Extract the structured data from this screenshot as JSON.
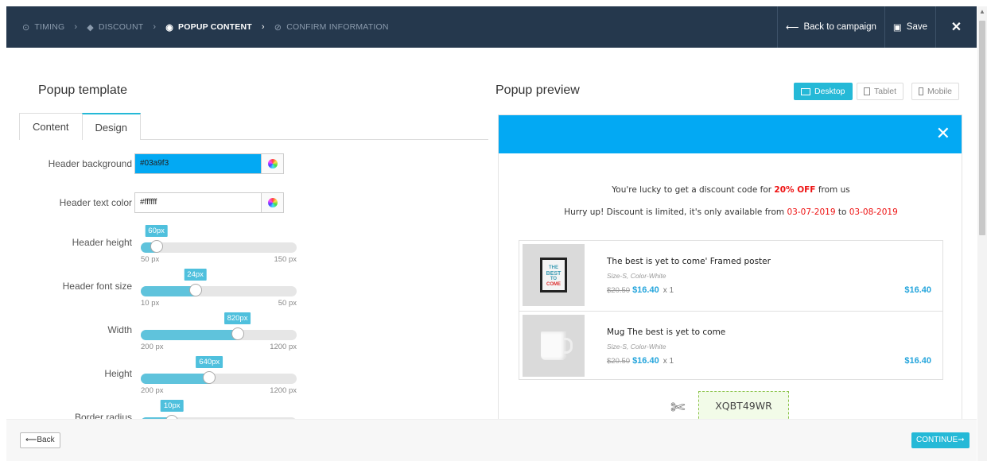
{
  "steps": [
    {
      "label": "TIMING",
      "icon": "clock-icon",
      "state": "done"
    },
    {
      "label": "DISCOUNT",
      "icon": "tag-icon",
      "state": "done"
    },
    {
      "label": "POPUP CONTENT",
      "icon": "eye-icon",
      "state": "active"
    },
    {
      "label": "CONFIRM INFORMATION",
      "icon": "check-circle-icon",
      "state": "pending"
    }
  ],
  "nav": {
    "back_label": "Back to campaign",
    "save_label": "Save"
  },
  "left": {
    "title": "Popup template",
    "tabs": [
      "Content",
      "Design"
    ],
    "active_tab": "Design",
    "fields": {
      "header_background": {
        "label": "Header background",
        "value": "#03a9f3"
      },
      "header_text_color": {
        "label": "Header text color",
        "value": "#ffffff"
      }
    },
    "sliders": [
      {
        "label": "Header height",
        "value": "60px",
        "min": "50 px",
        "max": "150 px",
        "fraction": 0.1
      },
      {
        "label": "Header font size",
        "value": "24px",
        "min": "10 px",
        "max": "50 px",
        "fraction": 0.35
      },
      {
        "label": "Width",
        "value": "820px",
        "min": "200 px",
        "max": "1200 px",
        "fraction": 0.62
      },
      {
        "label": "Height",
        "value": "640px",
        "min": "200 px",
        "max": "1200 px",
        "fraction": 0.44
      },
      {
        "label": "Border radius",
        "value": "10px",
        "min": "",
        "max": "",
        "fraction": 0.2
      }
    ]
  },
  "right": {
    "title": "Popup preview",
    "devices": [
      "Desktop",
      "Tablet",
      "Mobile"
    ],
    "active_device": "Desktop"
  },
  "popup": {
    "header_color": "#03a9f3",
    "line1_pre": "You're lucky to get a discount code for ",
    "line1_discount": "20% OFF",
    "line1_post": " from us",
    "line2_pre": "Hurry up! Discount is limited, it's only available from ",
    "line2_from": "03-07-2019",
    "line2_mid": " to ",
    "line2_to": "03-08-2019",
    "products": [
      {
        "name": "The best is yet to come' Framed poster",
        "variant": "Size-S, Color-White",
        "old_price": "$20.50",
        "price": "$16.40",
        "qty": "x 1",
        "total": "$16.40"
      },
      {
        "name": "Mug The best is yet to come",
        "variant": "Size-S, Color-White",
        "old_price": "$20.50",
        "price": "$16.40",
        "qty": "x 1",
        "total": "$16.40"
      }
    ],
    "coupon_code": "XQBT49WR",
    "poster_text": [
      "THE",
      "BEST",
      "TO",
      "COME"
    ]
  },
  "footer": {
    "back_label": "Back",
    "continue_label": "CONTINUE"
  }
}
